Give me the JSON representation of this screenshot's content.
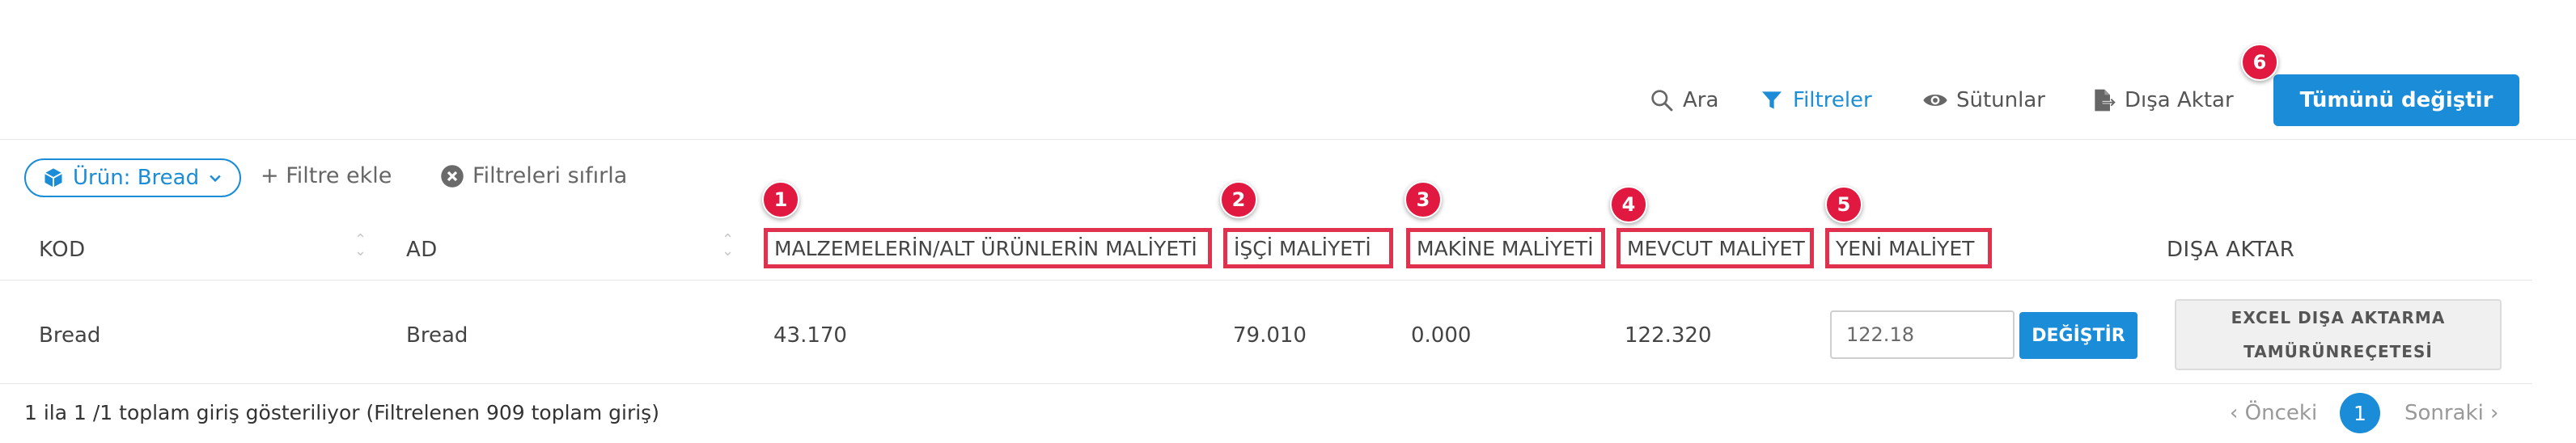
{
  "toolbar": {
    "search_label": "Ara",
    "filters_label": "Filtreler",
    "columns_label": "Sütunlar",
    "export_label": "Dışa Aktar",
    "change_all_label": "Tümünü değiştir"
  },
  "filters": {
    "chip_label": "Ürün: Bread",
    "add_filter_label": "+ Filtre ekle",
    "reset_label": "Filtreleri sıfırla"
  },
  "badges": [
    "1",
    "2",
    "3",
    "4",
    "5",
    "6"
  ],
  "table": {
    "headers": {
      "kod": "KOD",
      "ad": "AD",
      "materials_cost": "MALZEMELERİN/ALT ÜRÜNLERİN MALİYETİ",
      "labor_cost": "İŞÇİ MALİYETİ",
      "machine_cost": "MAKİNE MALİYETİ",
      "current_cost": "MEVCUT MALİYET",
      "new_cost": "YENİ MALİYET",
      "export": "DIŞA AKTAR"
    },
    "rows": [
      {
        "kod": "Bread",
        "ad": "Bread",
        "materials_cost": "43.170",
        "labor_cost": "79.010",
        "machine_cost": "0.000",
        "current_cost": "122.320",
        "new_cost_value": "122.18",
        "change_label": "DEĞİŞTİR",
        "export_line1": "EXCEL DIŞA AKTARMA",
        "export_line2": "TAMÜRÜNREÇETESİ"
      }
    ]
  },
  "footer": {
    "info": "1 ila 1 /1 toplam giriş gösteriliyor (Filtrelenen 909 toplam giriş)",
    "prev_label": "‹ Önceki",
    "page": "1",
    "next_label": "Sonraki ›"
  },
  "colors": {
    "accent": "#1a8cd8",
    "highlight": "#e0314f",
    "badge": "#e1183f"
  }
}
